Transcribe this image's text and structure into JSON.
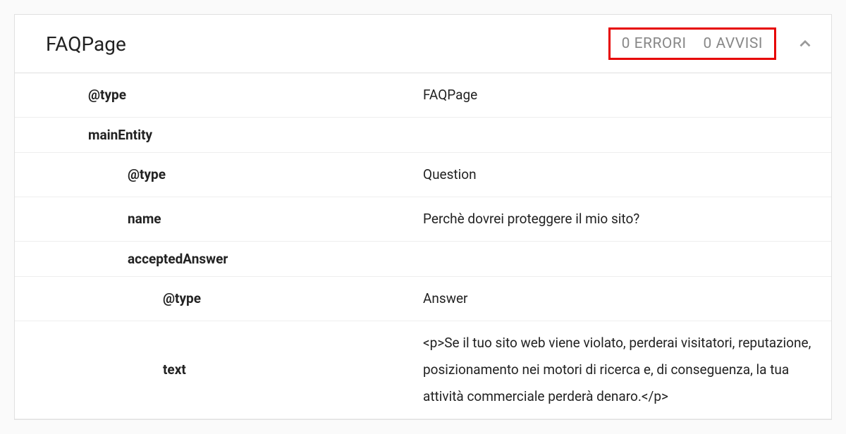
{
  "header": {
    "title": "FAQPage",
    "errors": "0 ERRORI",
    "warnings": "0 AVVISI"
  },
  "rows": [
    {
      "key": "@type",
      "value": "FAQPage",
      "bold": true,
      "indent": 1
    },
    {
      "key": "mainEntity",
      "value": "",
      "bold": true,
      "indent": 1
    },
    {
      "key": "@type",
      "value": "Question",
      "bold": true,
      "indent": 2
    },
    {
      "key": "name",
      "value": "Perchè dovrei proteggere il mio sito?",
      "bold": true,
      "indent": 2
    },
    {
      "key": "acceptedAnswer",
      "value": "",
      "bold": true,
      "indent": 2
    },
    {
      "key": "@type",
      "value": "Answer",
      "bold": true,
      "indent": 3
    },
    {
      "key": "text",
      "value": "<p>Se il tuo sito web viene violato, perderai visitatori, reputazione, posizionamento nei motori di ricerca e, di conseguenza, la tua attività commerciale perderà denaro.</p>",
      "bold": true,
      "indent": 3
    }
  ]
}
